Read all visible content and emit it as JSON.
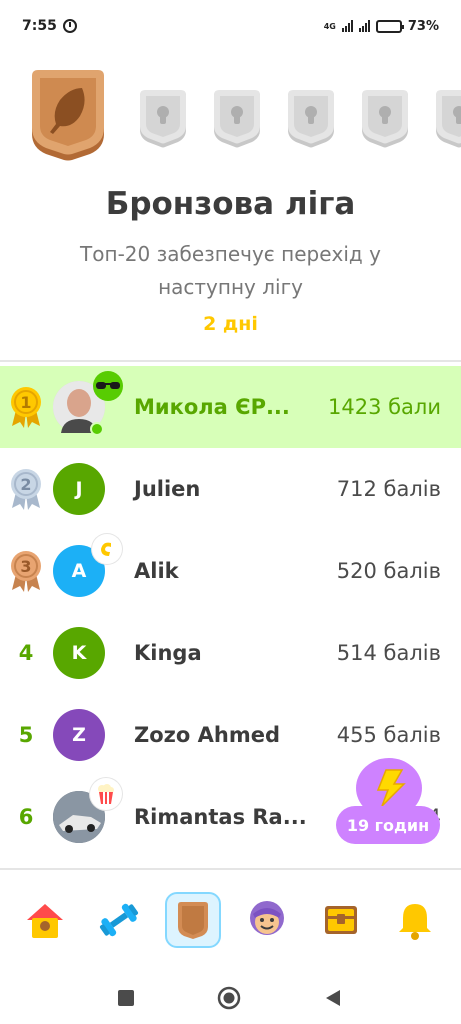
{
  "status": {
    "time": "7:55",
    "network": "4G",
    "battery_pct": "73",
    "battery_level": 0.73
  },
  "league": {
    "title": "Бронзова ліга",
    "subtitle": "Топ-20 забезпечує перехід у наступну лігу",
    "days_left": "2 дні",
    "badges": [
      "bronze",
      "locked",
      "locked",
      "locked",
      "locked",
      "locked"
    ]
  },
  "leaderboard": [
    {
      "rank": "1",
      "name": "Микола ЄР...",
      "points": "1423 бали",
      "avatar_letter": "",
      "avatar_color": "#cfcfcf",
      "medal": "gold",
      "is_me": true
    },
    {
      "rank": "2",
      "name": "Julien",
      "points": "712 балів",
      "avatar_letter": "J",
      "avatar_color": "#58a700",
      "medal": "silver",
      "is_me": false
    },
    {
      "rank": "3",
      "name": "Alik",
      "points": "520 балів",
      "avatar_letter": "A",
      "avatar_color": "#1cb0f6",
      "medal": "bronze",
      "is_me": false
    },
    {
      "rank": "4",
      "name": "Kinga",
      "points": "514 балів",
      "avatar_letter": "K",
      "avatar_color": "#58a700",
      "medal": "",
      "is_me": false
    },
    {
      "rank": "5",
      "name": "Zozo Ahmed",
      "points": "455 балів",
      "avatar_letter": "Z",
      "avatar_color": "#8549ba",
      "medal": "",
      "is_me": false
    },
    {
      "rank": "6",
      "name": "Rimantas Ra...",
      "points": "4",
      "avatar_letter": "",
      "avatar_color": "#5a6470",
      "medal": "",
      "is_me": false
    }
  ],
  "boost": {
    "label": "19 годин"
  },
  "tabs": [
    {
      "name": "home",
      "icon": "house-icon"
    },
    {
      "name": "practice",
      "icon": "dumbbell-icon"
    },
    {
      "name": "leagues",
      "icon": "shield-icon",
      "active": true
    },
    {
      "name": "profile",
      "icon": "character-icon"
    },
    {
      "name": "shop",
      "icon": "chest-icon"
    },
    {
      "name": "notifications",
      "icon": "bell-icon"
    }
  ],
  "colors": {
    "green": "#58a700",
    "highlight": "#d7ffb8",
    "gold": "#ffc800",
    "purple": "#ce82ff"
  }
}
